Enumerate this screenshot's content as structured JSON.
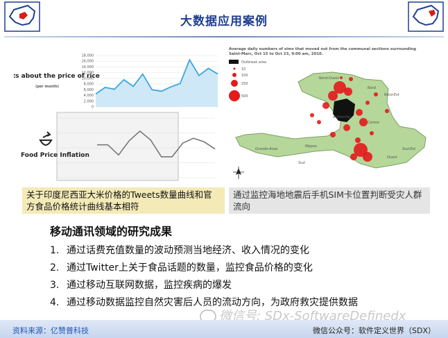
{
  "header": {
    "title": "大数据应用案例"
  },
  "left_panel": {
    "tweets_label": "Tweets about the price of rice",
    "tweets_sublabel": "(per month)",
    "tweets_yticks": [
      "18,000",
      "16,000",
      "14,000",
      "12,000",
      "10,000",
      "8,000",
      "6,000",
      "4,000",
      "2,000",
      "0"
    ],
    "food_label": "Food Price Inflation",
    "caption": "关于印度尼西亚大米价格的Tweets数量曲线和官方食品价格统计曲线基本相符"
  },
  "right_panel": {
    "map_title": "Average daily numbers of sims that moved out from the communal sections surrounding Saint-Marc, Oct 15 to Oct 23, 9:00 am, 2010.",
    "legend_outbreak": "Outbreak area",
    "legend_values": [
      "10",
      "100",
      "250",
      "500"
    ],
    "regions": [
      "Nord-Ouest",
      "Nord",
      "Nord-Est",
      "Artibonite",
      "Centre",
      "Ouest",
      "Sud-Est",
      "Grande-Anse",
      "Nippes",
      "Sud"
    ],
    "caption": "通过监控海地地震后手机SIM卡位置判断受灾人群流向"
  },
  "chart_data": [
    {
      "type": "line",
      "title": "",
      "xlabel": "",
      "ylabel": "",
      "ylim": [
        0,
        18000
      ],
      "series": [
        {
          "values": [
            4500,
            6800,
            6200,
            9500,
            7200,
            11500,
            6000,
            5500,
            7000,
            8200,
            16500,
            11000,
            13500,
            11500
          ]
        }
      ],
      "color": "#3aa6e0",
      "fill": "#cfe8f8"
    },
    {
      "type": "line",
      "title": "",
      "series": [
        {
          "values": [
            0.55,
            0.55,
            0.38,
            0.62,
            0.78,
            0.63,
            0.35,
            0.35,
            0.58,
            0.66,
            0.6,
            0.48
          ]
        }
      ],
      "color": "#777777"
    }
  ],
  "section": {
    "title": "移动通讯领域的研究成果",
    "items": [
      {
        "num": "1.",
        "text": "通过话费充值数量的波动预测当地经济、收入情况的变化"
      },
      {
        "num": "2.",
        "text": "通过Twitter上关于食品话题的数量，监控食品价格的变化"
      },
      {
        "num": "3.",
        "text": "通过移动互联网数据，监控疾病的爆发"
      },
      {
        "num": "4.",
        "text": "通过移动数据监控自然灾害后人员的流动方向，为政府救灾提供数据"
      }
    ]
  },
  "footer": {
    "source": "资料来源：亿赞普科技",
    "right": "微信公众号：软件定义世界（SDX）",
    "watermark": "微信号: SDx-SoftwareDefinedx"
  }
}
